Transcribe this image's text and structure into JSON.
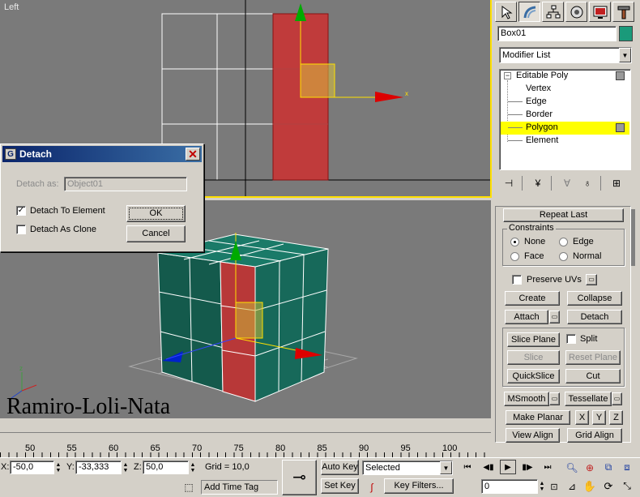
{
  "viewports": {
    "top_left_label": "Left"
  },
  "dialog": {
    "title": "Detach",
    "detach_as_label": "Detach as:",
    "detach_as_value": "Object01",
    "detach_to_element_label": "Detach To Element",
    "detach_to_element_checked": true,
    "detach_as_clone_label": "Detach As Clone",
    "detach_as_clone_checked": false,
    "ok_label": "OK",
    "cancel_label": "Cancel"
  },
  "watermark": "Ramiro-Loli-Nata",
  "command_panel": {
    "object_name": "Box01",
    "object_color": "#1a9a7a",
    "modifier_list": "Modifier List",
    "stack": {
      "root": "Editable Poly",
      "items": [
        "Vertex",
        "Edge",
        "Border",
        "Polygon",
        "Element"
      ],
      "selected": "Polygon"
    },
    "repeat_last": "Repeat Last",
    "constraints": {
      "title": "Constraints",
      "none": "None",
      "edge": "Edge",
      "face": "Face",
      "normal": "Normal",
      "selected": "None"
    },
    "preserve_uvs": "Preserve UVs",
    "create": "Create",
    "collapse": "Collapse",
    "attach": "Attach",
    "detach": "Detach",
    "slice_plane": "Slice Plane",
    "split": "Split",
    "slice": "Slice",
    "reset_plane": "Reset Plane",
    "quickslice": "QuickSlice",
    "cut": "Cut",
    "msmooth": "MSmooth",
    "tessellate": "Tessellate",
    "make_planar": "Make Planar",
    "x": "X",
    "y": "Y",
    "z": "Z",
    "view_align": "View Align",
    "grid_align": "Grid Align"
  },
  "timeline": {
    "ticks": [
      "50",
      "55",
      "60",
      "65",
      "70",
      "75",
      "80",
      "85",
      "90",
      "95",
      "100"
    ]
  },
  "status": {
    "x_label": "X:",
    "x_value": "-50,0",
    "y_label": "Y:",
    "y_value": "-33,333",
    "z_label": "Z:",
    "z_value": "50,0",
    "grid": "Grid = 10,0",
    "add_time_tag": "Add Time Tag",
    "auto_key": "Auto Key",
    "set_key": "Set Key",
    "selected": "Selected",
    "key_filters": "Key Filters...",
    "frame": "0"
  }
}
